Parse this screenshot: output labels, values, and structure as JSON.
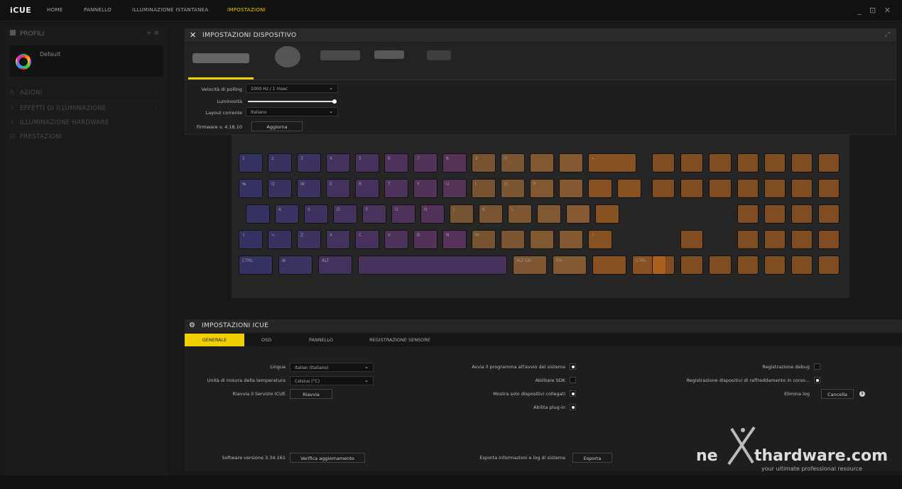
{
  "app": {
    "title": "iCUE"
  },
  "nav": {
    "items": [
      "HOME",
      "PANNELLO",
      "ILLUMINAZIONE ISTANTANEA",
      "IMPOSTAZIONI"
    ],
    "active_index": 3
  },
  "window_controls": "_ ⊡ ✕",
  "sidebar": {
    "header": "PROFILI",
    "header_tools": "+ ≡",
    "profile_name": "Default",
    "menu": [
      "AZIONI",
      "EFFETTI DI ILLUMINAZIONE",
      "ILLUMINAZIONE HARDWARE",
      "PRESTAZIONI"
    ]
  },
  "device_panel": {
    "title": "IMPOSTAZIONI DISPOSITIVO",
    "polling_label": "Velocità di polling",
    "polling_value": "1000 Hz / 1 msec",
    "brightness_label": "Luminosità",
    "brightness_level": 1.0,
    "layout_label": "Layout corrente",
    "layout_value": "Italiano",
    "firmware_label": "Firmware v. 4.18.10",
    "update_button": "Aggiorna"
  },
  "keyboard": {
    "keys_row1": [
      "1",
      "2",
      "3",
      "4",
      "5",
      "6",
      "7",
      "8",
      "9",
      "0",
      "",
      "",
      "←"
    ],
    "keys_row2": [
      "↹",
      "Q",
      "W",
      "E",
      "R",
      "T",
      "Y",
      "U",
      "I",
      "O",
      "P",
      "",
      "",
      ""
    ],
    "keys_row3": [
      "",
      "A",
      "S",
      "D",
      "F",
      "G",
      "H",
      "J",
      "K",
      "L",
      "",
      "",
      ""
    ],
    "keys_row4": [
      "⇧",
      "<",
      "Z",
      "X",
      "C",
      "V",
      "B",
      "N",
      "M",
      "",
      "",
      "",
      "⇧"
    ],
    "keys_row5": [
      "CTRL",
      "⊞",
      "ALT",
      "",
      "ALT GR",
      "FN",
      "",
      "CTRL"
    ]
  },
  "icue_panel": {
    "title": "IMPOSTAZIONI ICUE",
    "tabs": [
      "GENERALE",
      "OSD",
      "PANNELLO",
      "REGISTRAZIONE SENSORE"
    ],
    "active_tab": 0,
    "lingua_label": "Lingua",
    "lingua_value": "Italian (Italiano)",
    "temp_label": "Unità di misura della temperatura",
    "temp_value": "Celsius (°C)",
    "restart_label": "Riavvia il Servizio ICUE",
    "restart_button": "Riavvia",
    "startup_label": "Avvia il programma all'avvio del sistema",
    "sdk_label": "Abilitare SDK",
    "connected_label": "Mostra solo dispositivi collegati",
    "plugin_label": "Abilita plug-in",
    "debug_label": "Registrazione debug",
    "cooling_label": "Registrazione dispositivi di raffreddamento in corso...",
    "log_label": "Elimina log",
    "log_button": "Cancella",
    "version_label": "Software versione 3.34.161",
    "check_button": "Verifica aggiornamento",
    "export_label": "Esporta informazioni e log di sistema",
    "export_button": "Esporta",
    "checks": {
      "startup": true,
      "sdk": false,
      "connected": true,
      "plugin": true,
      "debug": false,
      "cooling": true
    }
  },
  "watermark": {
    "ne": "ne",
    "brand": "thardware.com",
    "tagline": "your ultimate professional resource"
  },
  "colors": {
    "accent": "#f0d000",
    "panel": "#1e1e1e",
    "background": "#181818"
  }
}
